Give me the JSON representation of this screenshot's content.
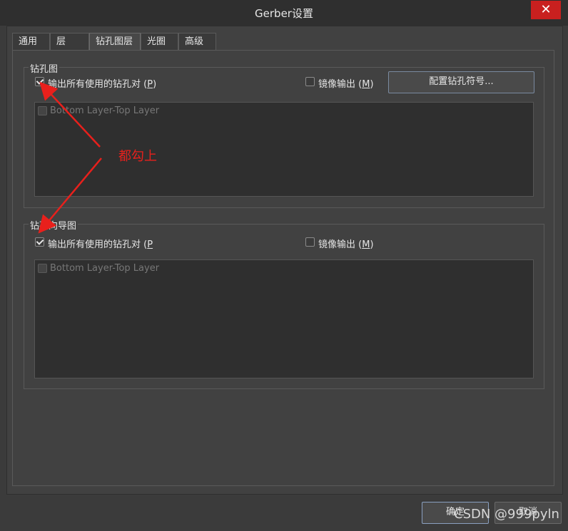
{
  "window": {
    "title": "Gerber设置",
    "close_label": "✕"
  },
  "tabs": [
    {
      "label": "通用"
    },
    {
      "label": "层"
    },
    {
      "label": "钻孔图层"
    },
    {
      "label": "光圈"
    },
    {
      "label": "高级"
    }
  ],
  "drill_drawing": {
    "title": "钻孔图",
    "all_pairs_label": "输出所有使用的钻孔对 (",
    "all_pairs_key": "P",
    "all_pairs_end": ")",
    "all_pairs_checked": true,
    "mirror_label": "镜像输出 (",
    "mirror_key": "M",
    "mirror_end": ")",
    "mirror_checked": false,
    "config_button": "配置钻孔符号...",
    "layer_pair": "Bottom Layer-Top Layer"
  },
  "drill_guide": {
    "title": "钻孔向导图",
    "all_pairs_label": "输出所有使用的钻孔对 (",
    "all_pairs_key": "P",
    "mirror_label": "镜像输出 (",
    "mirror_key": "M",
    "mirror_end": ")",
    "all_pairs_checked": true,
    "mirror_checked": false,
    "layer_pair": "Bottom Layer-Top Layer"
  },
  "annotation": {
    "text": "都勾上",
    "color": "#e8201c"
  },
  "footer": {
    "ok_label": "确定",
    "cancel_label": "取消"
  },
  "watermark": "CSDN @999pyln"
}
